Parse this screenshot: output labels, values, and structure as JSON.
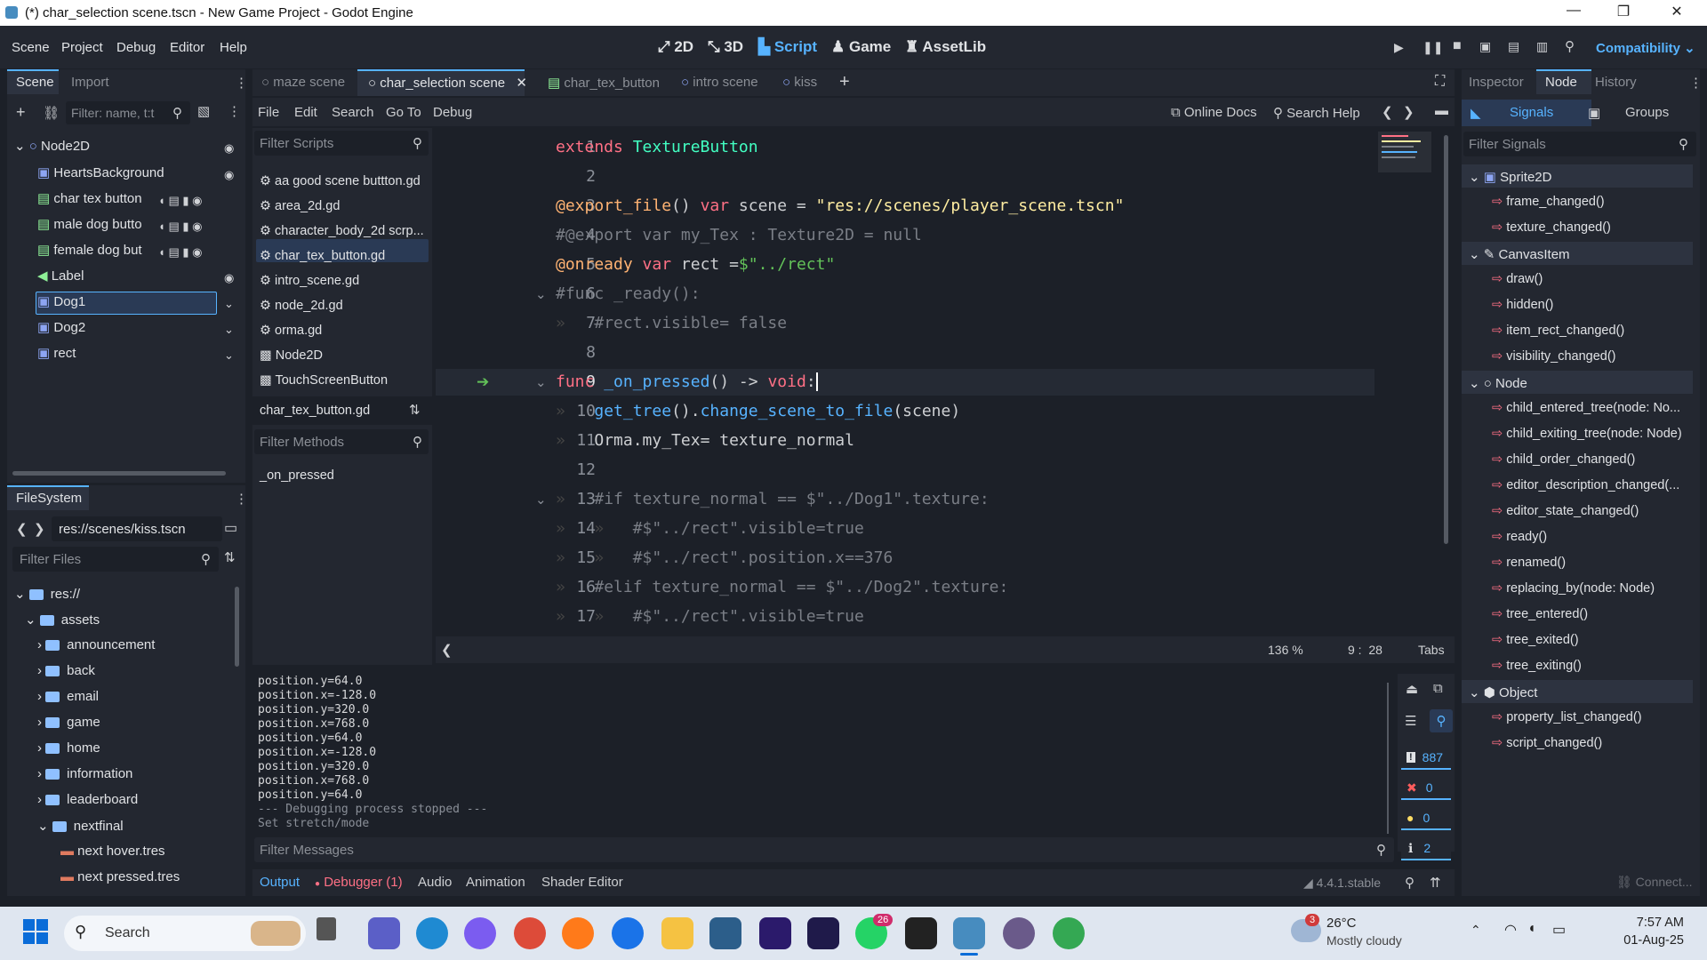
{
  "window": {
    "title": "(*) char_selection scene.tscn - New Game Project - Godot Engine"
  },
  "menu": [
    "Scene",
    "Project",
    "Debug",
    "Editor",
    "Help"
  ],
  "modes": [
    "2D",
    "3D",
    "Script",
    "Game",
    "AssetLib"
  ],
  "renderer": "Compatibility",
  "scene_dock": {
    "tabs": [
      "Scene",
      "Import"
    ],
    "filter_placeholder": "Filter: name, t:t",
    "nodes": [
      "Node2D",
      "HeartsBackground",
      "char tex button",
      "male dog butto",
      "female dog but",
      "Label",
      "Dog1",
      "Dog2",
      "rect"
    ]
  },
  "filesystem": {
    "tab": "FileSystem",
    "path": "res://scenes/kiss.tscn",
    "filter_placeholder": "Filter Files",
    "items": [
      "res://",
      "assets",
      "announcement",
      "back",
      "email",
      "game",
      "home",
      "information",
      "leaderboard",
      "nextfinal",
      "next hover.tres",
      "next pressed.tres"
    ]
  },
  "scene_tabs": [
    "maze scene",
    "char_selection scene",
    "char_tex_button",
    "intro scene",
    "kiss"
  ],
  "script_menu": [
    "File",
    "Edit",
    "Search",
    "Go To",
    "Debug"
  ],
  "script_help": [
    "Online Docs",
    "Search Help"
  ],
  "scripts": {
    "filter_placeholder": "Filter Scripts",
    "items": [
      "aa good scene buttton.gd",
      "area_2d.gd",
      "character_body_2d scrp...",
      "char_tex_button.gd",
      "intro_scene.gd",
      "node_2d.gd",
      "orma.gd",
      "Node2D",
      "TouchScreenButton"
    ],
    "current": "char_tex_button.gd",
    "methods_placeholder": "Filter Methods",
    "methods": [
      "_on_pressed"
    ]
  },
  "code": {
    "line_numbers": [
      "1",
      "2",
      "3",
      "4",
      "5",
      "6",
      "7",
      "8",
      "9",
      "10",
      "11",
      "12",
      "13",
      "14",
      "15",
      "16",
      "17"
    ],
    "zoom": "136 %",
    "cursor": "9 :  28",
    "indent": "Tabs"
  },
  "output": {
    "lines": [
      "position.y=64.0",
      "position.x=-128.0",
      "position.y=320.0",
      "position.x=768.0",
      "position.y=64.0",
      "position.x=-128.0",
      "position.y=320.0",
      "position.x=768.0",
      "position.y=64.0",
      "--- Debugging process stopped ---",
      "Set stretch/mode"
    ],
    "filter_placeholder": "Filter Messages",
    "counts": [
      "887",
      "0",
      "0",
      "2"
    ],
    "bottom_tabs": [
      "Output",
      "Debugger (1)",
      "Audio",
      "Animation",
      "Shader Editor"
    ],
    "version": "4.4.1.stable"
  },
  "inspector": {
    "tabs": [
      "Inspector",
      "Node",
      "History"
    ],
    "subtabs": [
      "Signals",
      "Groups"
    ],
    "filter_placeholder": "Filter Signals",
    "categories": [
      "Sprite2D",
      "CanvasItem",
      "Node",
      "Object"
    ],
    "signals": [
      "frame_changed()",
      "texture_changed()",
      "draw()",
      "hidden()",
      "item_rect_changed()",
      "visibility_changed()",
      "child_entered_tree(node: No...",
      "child_exiting_tree(node: Node)",
      "child_order_changed()",
      "editor_description_changed(...",
      "editor_state_changed()",
      "ready()",
      "renamed()",
      "replacing_by(node: Node)",
      "tree_entered()",
      "tree_exited()",
      "tree_exiting()",
      "property_list_changed()",
      "script_changed()"
    ],
    "connect": "Connect..."
  },
  "taskbar": {
    "search": "Search",
    "weather_temp": "26°C",
    "weather_desc": "Mostly cloudy",
    "weather_badge": "3",
    "whatsapp_badge": "26",
    "time": "7:57 AM",
    "date": "01-Aug-25"
  }
}
